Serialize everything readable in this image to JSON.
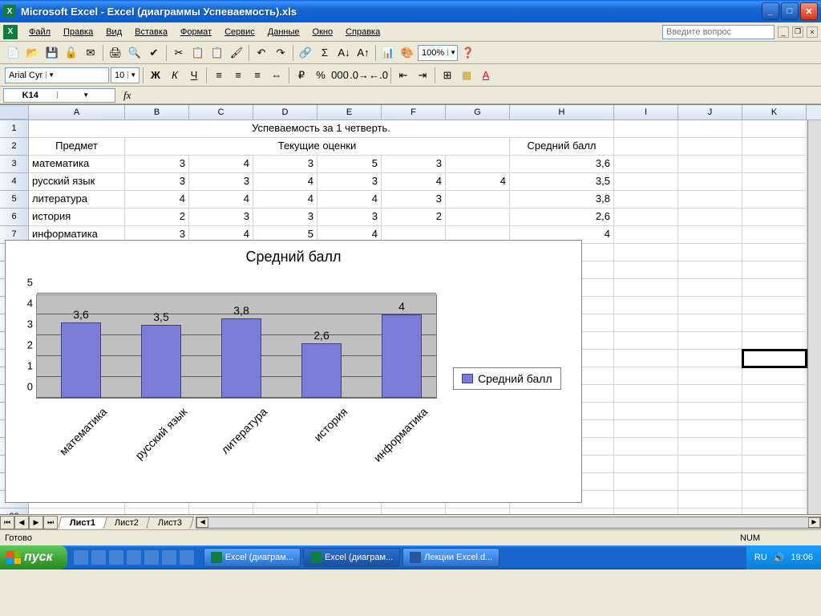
{
  "titlebar": {
    "title": "Microsoft Excel - Excel (диаграммы Успеваемость).xls"
  },
  "menubar": {
    "file": "Файл",
    "edit": "Правка",
    "view": "Вид",
    "insert": "Вставка",
    "format": "Формат",
    "tools": "Сервис",
    "data": "Данные",
    "window": "Окно",
    "help": "Справка",
    "help_placeholder": "Введите вопрос"
  },
  "toolbar": {
    "font_name": "Arial Cyr",
    "font_size": "10",
    "zoom": "100%"
  },
  "namebox": {
    "cell_ref": "K14"
  },
  "columns": [
    "A",
    "B",
    "C",
    "D",
    "E",
    "F",
    "G",
    "H",
    "I",
    "J",
    "K"
  ],
  "rows_shown": 23,
  "sheet": {
    "title_row": "Успеваемость за 1 четверть.",
    "header": {
      "subject": "Предмет",
      "grades": "Текущие оценки",
      "avg": "Средний балл"
    },
    "data": [
      {
        "subject": "математика",
        "grades": [
          "3",
          "4",
          "3",
          "5",
          "3",
          ""
        ],
        "avg": "3,6"
      },
      {
        "subject": "русский язык",
        "grades": [
          "3",
          "3",
          "4",
          "3",
          "4",
          "4"
        ],
        "avg": "3,5"
      },
      {
        "subject": "литература",
        "grades": [
          "4",
          "4",
          "4",
          "4",
          "3",
          ""
        ],
        "avg": "3,8"
      },
      {
        "subject": "история",
        "grades": [
          "2",
          "3",
          "3",
          "3",
          "2",
          ""
        ],
        "avg": "2,6"
      },
      {
        "subject": "информатика",
        "grades": [
          "3",
          "4",
          "5",
          "4",
          "",
          ""
        ],
        "avg": "4"
      }
    ]
  },
  "chart_data": {
    "type": "bar",
    "title": "Средний балл",
    "categories": [
      "математика",
      "русский язык",
      "литература",
      "история",
      "информатика"
    ],
    "values": [
      3.6,
      3.5,
      3.8,
      2.6,
      4
    ],
    "value_labels": [
      "3,6",
      "3,5",
      "3,8",
      "2,6",
      "4"
    ],
    "ylim": [
      0,
      5
    ],
    "yticks": [
      0,
      1,
      2,
      3,
      4,
      5
    ],
    "legend": "Средний балл"
  },
  "sheets": {
    "tabs": [
      "Лист1",
      "Лист2",
      "Лист3"
    ],
    "active": 0
  },
  "statusbar": {
    "ready": "Готово",
    "num": "NUM"
  },
  "taskbar": {
    "start": "пуск",
    "tasks": [
      {
        "label": "Excel (диаграм...",
        "kind": "excel",
        "active": false
      },
      {
        "label": "Excel (диаграм...",
        "kind": "excel",
        "active": true
      },
      {
        "label": "Лекции Excel.d...",
        "kind": "word",
        "active": false
      }
    ],
    "lang": "RU",
    "clock": "19:06"
  }
}
